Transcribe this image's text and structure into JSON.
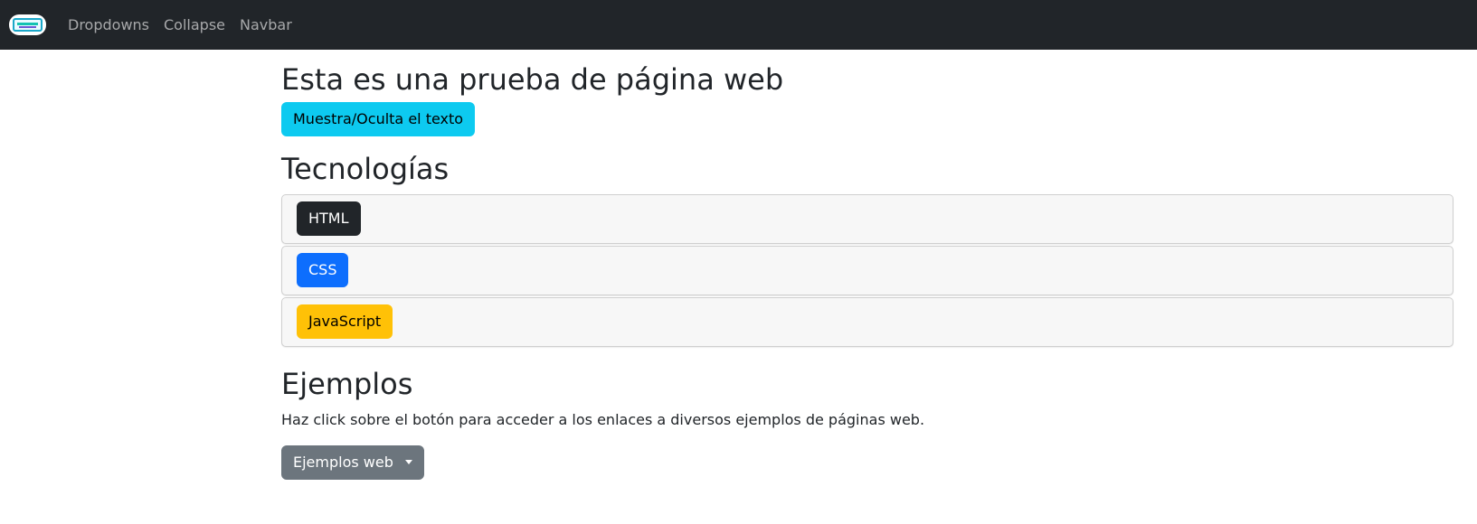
{
  "navbar": {
    "logo_icon": "brand-logo-icon",
    "links": [
      "Dropdowns",
      "Collapse",
      "Navbar"
    ]
  },
  "main": {
    "title": "Esta es una prueba de página web",
    "toggle_button": "Muestra/Oculta el texto",
    "tech_heading": "Tecnologías",
    "technologies": [
      {
        "label": "HTML",
        "color": "#212529"
      },
      {
        "label": "CSS",
        "color": "#0d6efd"
      },
      {
        "label": "JavaScript",
        "color": "#ffc107"
      }
    ],
    "examples_heading": "Ejemplos",
    "examples_text": "Haz click sobre el botón para acceder a los enlaces a diversos ejemplos de páginas web.",
    "examples_button": "Ejemplos web"
  }
}
